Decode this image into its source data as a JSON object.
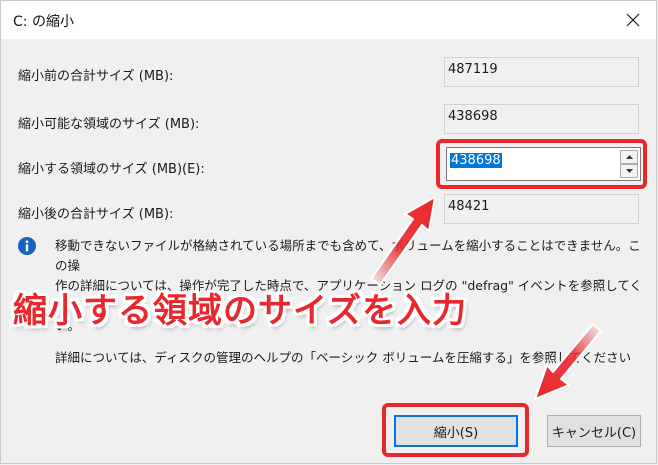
{
  "window": {
    "title": "C: の縮小"
  },
  "fields": [
    {
      "label": "縮小前の合計サイズ (MB):",
      "value": "487119"
    },
    {
      "label": "縮小可能な領域のサイズ (MB):",
      "value": "438698"
    },
    {
      "label": "縮小する領域のサイズ (MB)(E):",
      "value": "438698"
    },
    {
      "label": "縮小後の合計サイズ (MB):",
      "value": "48421"
    }
  ],
  "info": {
    "line1": "移動できないファイルが格納されている場所までも含めて、ボリュームを縮小することはできません。この操",
    "line2": "作の詳細については、操作が完了した時点で、アプリケーション ログの \"defrag\" イベントを参照してくださ",
    "line3": "い。"
  },
  "callout": "縮小する領域のサイズを入力",
  "help_text": "詳細については、ディスクの管理のヘルプの「ベーシック ボリュームを圧縮する」を参照してください",
  "buttons": {
    "shrink": "縮小(S)",
    "cancel": "キャンセル(C)"
  },
  "colors": {
    "highlight_red": "#e8282c",
    "selection_blue": "#0078d7",
    "info_icon_blue": "#1565c0"
  }
}
